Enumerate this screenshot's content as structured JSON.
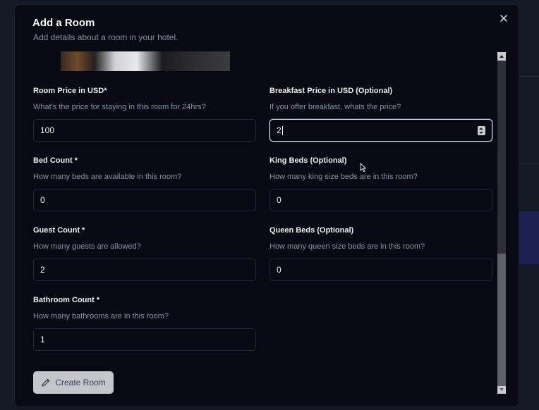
{
  "dialog": {
    "title": "Add a Room",
    "description": "Add details about a room in your hotel.",
    "close_icon": "close-icon"
  },
  "fields": {
    "room_price": {
      "label": "Room Price in USD*",
      "help": "What's the price for staying in this room for 24hrs?",
      "value": "100"
    },
    "breakfast_price": {
      "label": "Breakfast Price in USD (Optional)",
      "help": "If you offer breakfast, whats the price?",
      "value": "2"
    },
    "bed_count": {
      "label": "Bed Count *",
      "help": "How many beds are available in this room?",
      "value": "0"
    },
    "king_beds": {
      "label": "King Beds (Optional)",
      "help": "How many king size beds are in this room?",
      "value": "0"
    },
    "guest_count": {
      "label": "Guest Count *",
      "help": "How many guests are allowed?",
      "value": "2"
    },
    "queen_beds": {
      "label": "Queen Beds (Optional)",
      "help": "How many queen size beds are in this room?",
      "value": "0"
    },
    "bathroom_count": {
      "label": "Bathroom Count *",
      "help": "How many bathrooms are in this room?",
      "value": "1"
    }
  },
  "actions": {
    "create_label": "Create Room",
    "create_icon": "pencil-icon"
  },
  "colors": {
    "dialog_bg": "#070a12",
    "button_bg": "#c4c6cb",
    "input_border": "#242b3a",
    "focus_border": "#d7dbe3"
  }
}
